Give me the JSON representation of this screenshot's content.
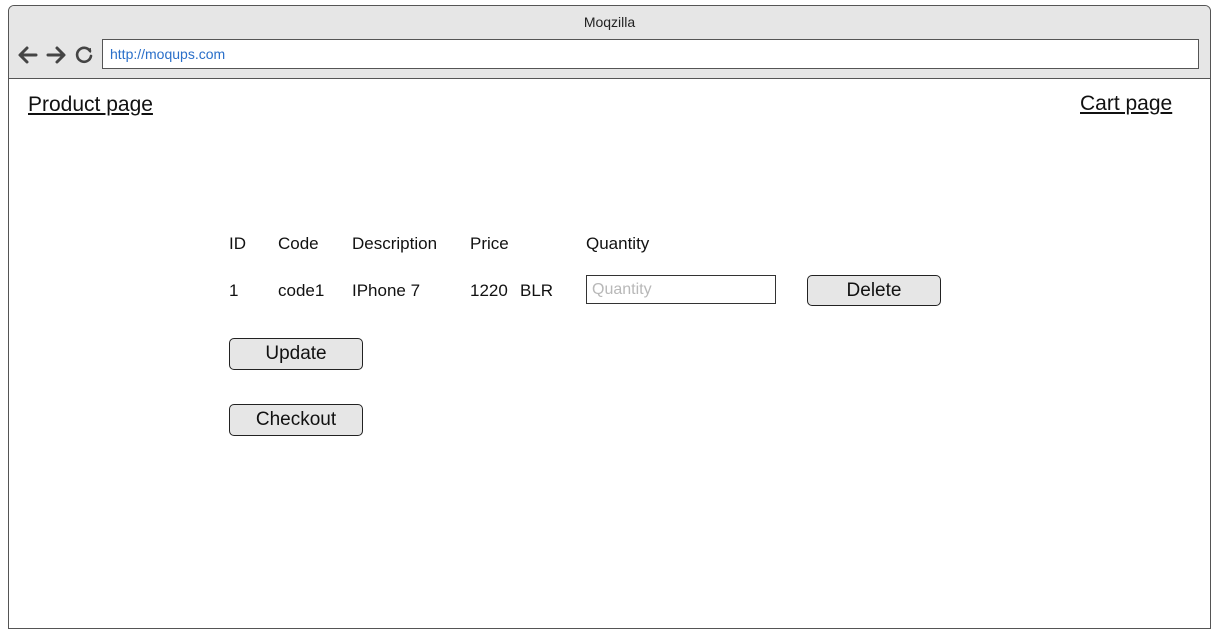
{
  "window": {
    "title": "Moqzilla",
    "address": "http://moqups.com"
  },
  "nav_icons": {
    "back": "arrow-left-icon",
    "forward": "arrow-right-icon",
    "reload": "reload-icon"
  },
  "links": {
    "product_page": "Product page",
    "cart_page": "Cart page"
  },
  "table": {
    "headers": [
      "ID",
      "Code",
      "Description",
      "Price",
      "Quantity"
    ],
    "rows": [
      {
        "id": "1",
        "code": "code1",
        "description": "IPhone 7",
        "price": "1220",
        "currency": "BLR",
        "quantity_value": "",
        "quantity_placeholder": "Quantity",
        "delete_label": "Delete"
      }
    ]
  },
  "actions": {
    "update_label": "Update",
    "checkout_label": "Checkout"
  },
  "colors": {
    "chrome_bg": "#e6e6e6",
    "address_text": "#2a6fc9",
    "button_bg": "#e6e6e6"
  }
}
